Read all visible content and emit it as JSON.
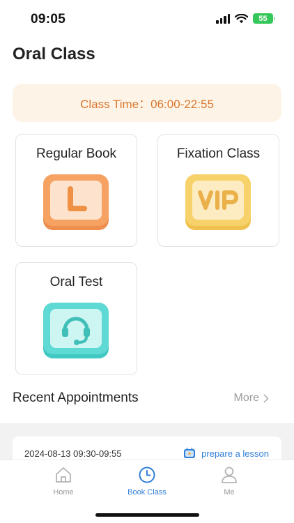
{
  "status_bar": {
    "time": "09:05",
    "battery": "55"
  },
  "page": {
    "title": "Oral Class"
  },
  "class_time": {
    "label": "Class Time：06:00-22:55"
  },
  "cards": [
    {
      "label": "Regular Book",
      "icon": "clock-icon",
      "color": "#f5a263"
    },
    {
      "label": "Fixation Class",
      "icon": "vip-icon",
      "color": "#f7d26a"
    },
    {
      "label": "Oral Test",
      "icon": "headset-icon",
      "color": "#5fd9d3"
    }
  ],
  "recent": {
    "title": "Recent Appointments",
    "more_label": "More",
    "appointments": [
      {
        "time": "2024-08-13 09:30-09:55",
        "action_label": "prepare a lesson"
      }
    ]
  },
  "tab_bar": {
    "items": [
      {
        "label": "Home",
        "icon": "home-icon",
        "active": false
      },
      {
        "label": "Book Class",
        "icon": "clock-icon",
        "active": true
      },
      {
        "label": "Me",
        "icon": "person-icon",
        "active": false
      }
    ]
  },
  "colors": {
    "accent": "#2f7fd8",
    "banner_bg": "#fdf4e7",
    "banner_text": "#d9772e"
  }
}
